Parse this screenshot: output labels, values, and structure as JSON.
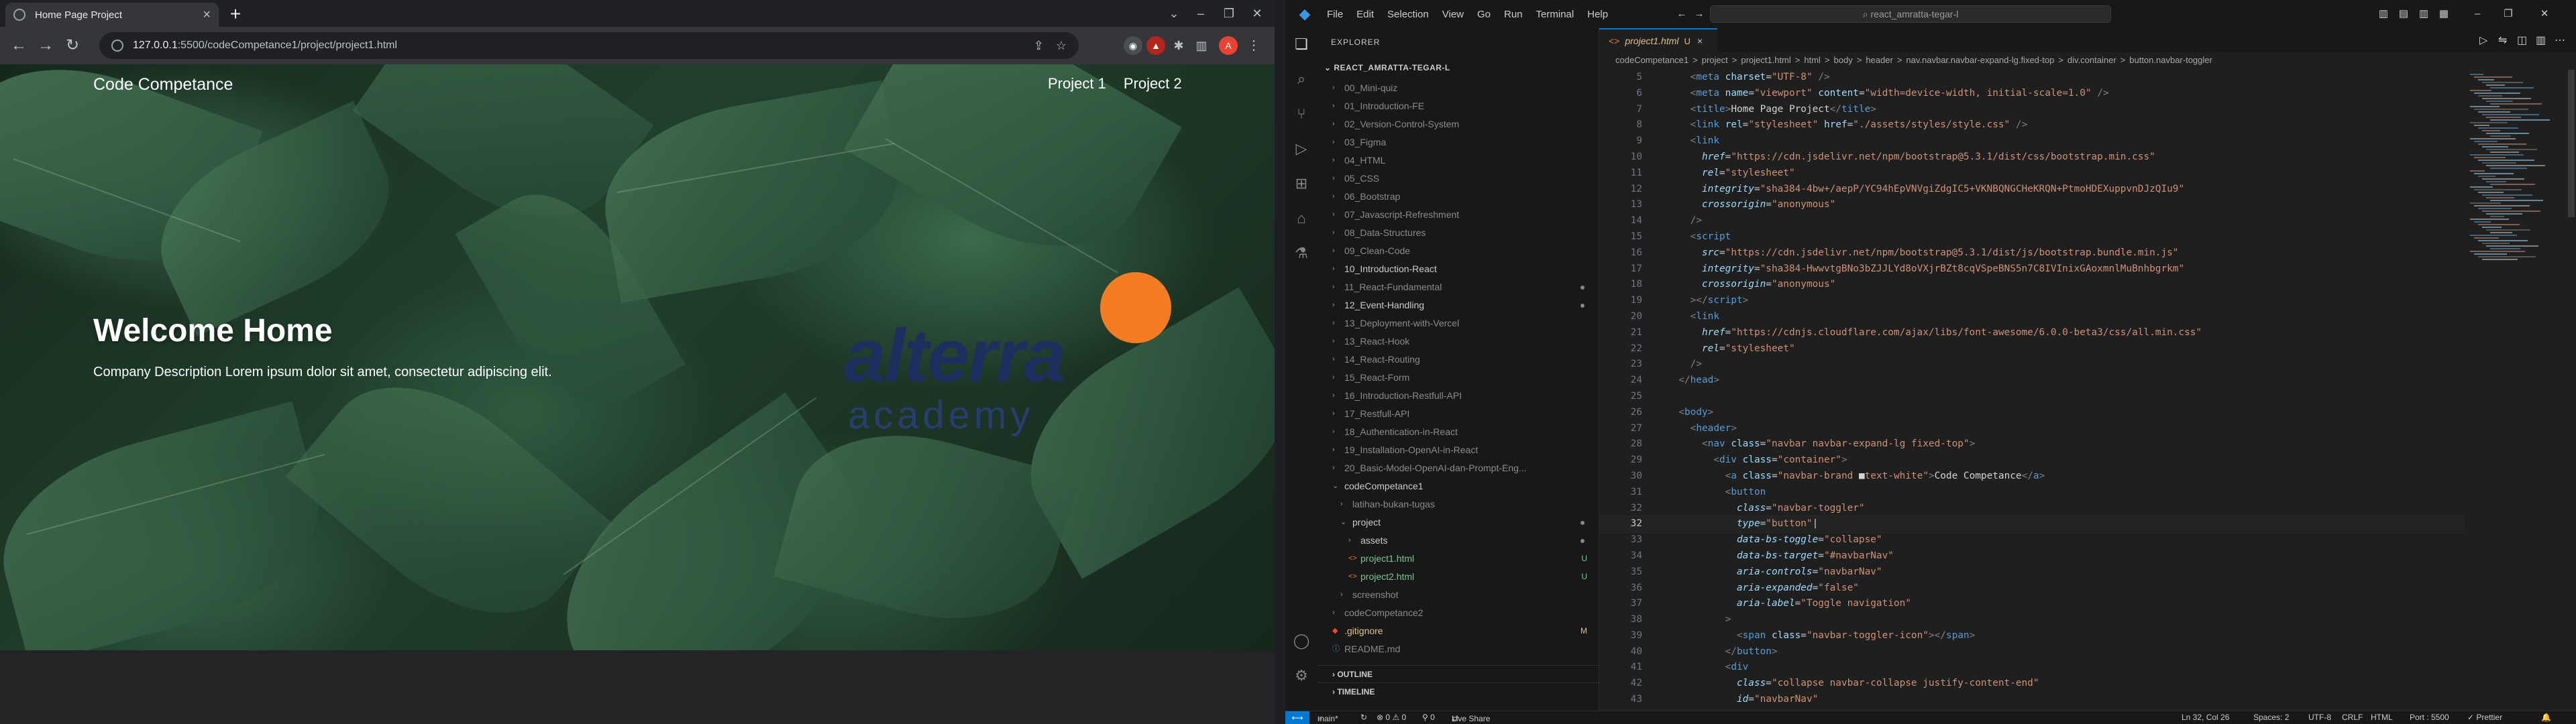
{
  "browser": {
    "tab_title": "Home Page Project",
    "url_host": "127.0.0.1",
    "url_rest": ":5500/codeCompetance1/project/project1.html",
    "profile_initial": "A"
  },
  "webpage": {
    "brand": "Code Competance",
    "nav_links": [
      "Project 1",
      "Project 2"
    ],
    "heading": "Welcome Home",
    "description": "Company Description Lorem ipsum dolor sit amet, consectetur adipiscing elit.",
    "logo_word": "alterra",
    "logo_sub": "academy"
  },
  "vscode": {
    "menu": [
      "File",
      "Edit",
      "Selection",
      "View",
      "Go",
      "Run",
      "Terminal",
      "Help"
    ],
    "command_center": "react_amratta-tegar-l",
    "explorer_title": "EXPLORER",
    "workspace": "REACT_AMRATTA-TEGAR-L",
    "tree": [
      {
        "label": "00_Mini-quiz",
        "indent": 1,
        "kind": "folder",
        "style": "dim"
      },
      {
        "label": "01_Introduction-FE",
        "indent": 1,
        "kind": "folder",
        "style": "dim"
      },
      {
        "label": "02_Version-Control-System",
        "indent": 1,
        "kind": "folder",
        "style": "dim"
      },
      {
        "label": "03_Figma",
        "indent": 1,
        "kind": "folder",
        "style": "dim"
      },
      {
        "label": "04_HTML",
        "indent": 1,
        "kind": "folder",
        "style": "dim"
      },
      {
        "label": "05_CSS",
        "indent": 1,
        "kind": "folder",
        "style": "dim"
      },
      {
        "label": "06_Bootstrap",
        "indent": 1,
        "kind": "folder",
        "style": "dim"
      },
      {
        "label": "07_Javascript-Refreshment",
        "indent": 1,
        "kind": "folder",
        "style": "dim"
      },
      {
        "label": "08_Data-Structures",
        "indent": 1,
        "kind": "folder",
        "style": "dim"
      },
      {
        "label": "09_Clean-Code",
        "indent": 1,
        "kind": "folder",
        "style": "dim"
      },
      {
        "label": "10_Introduction-React",
        "indent": 1,
        "kind": "folder",
        "style": "normal"
      },
      {
        "label": "11_React-Fundamental",
        "indent": 1,
        "kind": "folder",
        "style": "dim",
        "dot": true
      },
      {
        "label": "12_Event-Handling",
        "indent": 1,
        "kind": "folder",
        "style": "normal",
        "dot": true
      },
      {
        "label": "13_Deployment-with-Vercel",
        "indent": 1,
        "kind": "folder",
        "style": "dim"
      },
      {
        "label": "13_React-Hook",
        "indent": 1,
        "kind": "folder",
        "style": "dim"
      },
      {
        "label": "14_React-Routing",
        "indent": 1,
        "kind": "folder",
        "style": "dim"
      },
      {
        "label": "15_React-Form",
        "indent": 1,
        "kind": "folder",
        "style": "dim"
      },
      {
        "label": "16_Introduction-Restfull-API",
        "indent": 1,
        "kind": "folder",
        "style": "dim"
      },
      {
        "label": "17_Restfull-API",
        "indent": 1,
        "kind": "folder",
        "style": "dim"
      },
      {
        "label": "18_Authentication-in-React",
        "indent": 1,
        "kind": "folder",
        "style": "dim"
      },
      {
        "label": "19_Installation-OpenAI-in-React",
        "indent": 1,
        "kind": "folder",
        "style": "dim"
      },
      {
        "label": "20_Basic-Model-OpenAI-dan-Prompt-Eng...",
        "indent": 1,
        "kind": "folder",
        "style": "dim"
      },
      {
        "label": "codeCompetance1",
        "indent": 1,
        "kind": "folder-open",
        "style": "normal"
      },
      {
        "label": "latihan-bukan-tugas",
        "indent": 2,
        "kind": "folder",
        "style": "dim"
      },
      {
        "label": "project",
        "indent": 2,
        "kind": "folder-open",
        "style": "normal",
        "dot": true
      },
      {
        "label": "assets",
        "indent": 3,
        "kind": "folder",
        "style": "normal",
        "dot": true
      },
      {
        "label": "project1.html",
        "indent": 3,
        "kind": "html",
        "style": "green",
        "status": "U"
      },
      {
        "label": "project2.html",
        "indent": 3,
        "kind": "html",
        "style": "green",
        "status": "U"
      },
      {
        "label": "screenshot",
        "indent": 2,
        "kind": "folder",
        "style": "dim"
      },
      {
        "label": "codeCompetance2",
        "indent": 1,
        "kind": "folder",
        "style": "dim"
      },
      {
        "label": ".gitignore",
        "indent": 1,
        "kind": "git",
        "style": "orange",
        "status": "M"
      },
      {
        "label": "README.md",
        "indent": 1,
        "kind": "md",
        "style": "dim"
      }
    ],
    "outline": "OUTLINE",
    "timeline": "TIMELINE",
    "editor_tab": "project1.html",
    "editor_tab_status": "U",
    "breadcrumbs": [
      "codeCompetance1",
      ">",
      "project",
      ">",
      "project1.html",
      ">",
      "html",
      ">",
      "body",
      ">",
      "header",
      ">",
      "nav.navbar.navbar-expand-lg.fixed-top",
      ">",
      "div.container",
      ">",
      "button.navbar-toggler"
    ],
    "code_lines": [
      {
        "n": "5",
        "html": "    <span class='p'>&lt;</span><span class='t'>meta</span> <span class='a'>charset</span>=<span class='s'>\"UTF-8\"</span> <span class='p'>/&gt;</span>"
      },
      {
        "n": "6",
        "html": "    <span class='p'>&lt;</span><span class='t'>meta</span> <span class='a'>name</span>=<span class='s'>\"viewport\"</span> <span class='a'>content</span>=<span class='s'>\"width=device-width, initial-scale=1.0\"</span> <span class='p'>/&gt;</span>"
      },
      {
        "n": "7",
        "html": "    <span class='p'>&lt;</span><span class='t'>title</span><span class='p'>&gt;</span><span class='c'>Home Page Project</span><span class='p'>&lt;/</span><span class='t'>title</span><span class='p'>&gt;</span>"
      },
      {
        "n": "8",
        "html": "    <span class='p'>&lt;</span><span class='t'>link</span> <span class='a'>rel</span>=<span class='s'>\"stylesheet\"</span> <span class='a'>href</span>=<span class='s'>\"./assets/styles/style.css\"</span> <span class='p'>/&gt;</span>"
      },
      {
        "n": "9",
        "html": "    <span class='p'>&lt;</span><span class='t'>link</span>"
      },
      {
        "n": "10",
        "html": "      <span class='a i'>href</span>=<span class='s'>\"https://cdn.jsdelivr.net/npm/bootstrap@5.3.1/dist/css/bootstrap.min.css\"</span>"
      },
      {
        "n": "11",
        "html": "      <span class='a i'>rel</span>=<span class='s'>\"stylesheet\"</span>"
      },
      {
        "n": "12",
        "html": "      <span class='a i'>integrity</span>=<span class='s'>\"sha384-4bw+/aepP/YC94hEpVNVgiZdgIC5+VKNBQNGCHeKRQN+PtmoHDEXuppvnDJzQIu9\"</span>"
      },
      {
        "n": "13",
        "html": "      <span class='a i'>crossorigin</span>=<span class='s'>\"anonymous\"</span>"
      },
      {
        "n": "14",
        "html": "    <span class='p'>/&gt;</span>"
      },
      {
        "n": "15",
        "html": "    <span class='p'>&lt;</span><span class='t'>script</span>"
      },
      {
        "n": "16",
        "html": "      <span class='a i'>src</span>=<span class='s'>\"https://cdn.jsdelivr.net/npm/bootstrap@5.3.1/dist/js/bootstrap.bundle.min.js\"</span>"
      },
      {
        "n": "17",
        "html": "      <span class='a i'>integrity</span>=<span class='s'>\"sha384-HwwvtgBNo3bZJJLYd8oVXjrBZt8cqVSpeBNS5n7C8IVInixGAoxmnlMuBnhbgrkm\"</span>"
      },
      {
        "n": "18",
        "html": "      <span class='a i'>crossorigin</span>=<span class='s'>\"anonymous\"</span>"
      },
      {
        "n": "19",
        "html": "    <span class='p'>&gt;&lt;/</span><span class='t'>script</span><span class='p'>&gt;</span>"
      },
      {
        "n": "20",
        "html": "    <span class='p'>&lt;</span><span class='t'>link</span>"
      },
      {
        "n": "21",
        "html": "      <span class='a i'>href</span>=<span class='s'>\"https://cdnjs.cloudflare.com/ajax/libs/font-awesome/6.0.0-beta3/css/all.min.css\"</span>"
      },
      {
        "n": "22",
        "html": "      <span class='a i'>rel</span>=<span class='s'>\"stylesheet\"</span>"
      },
      {
        "n": "23",
        "html": "    <span class='p'>/&gt;</span>"
      },
      {
        "n": "24",
        "html": "  <span class='p'>&lt;/</span><span class='t'>head</span><span class='p'>&gt;</span>"
      },
      {
        "n": "25",
        "html": ""
      },
      {
        "n": "26",
        "html": "  <span class='p'>&lt;</span><span class='t'>body</span><span class='p'>&gt;</span>"
      },
      {
        "n": "27",
        "html": "    <span class='p'>&lt;</span><span class='t'>header</span><span class='p'>&gt;</span>"
      },
      {
        "n": "28",
        "html": "      <span class='p'>&lt;</span><span class='t'>nav</span> <span class='a'>class</span>=<span class='s'>\"navbar navbar-expand-lg fixed-top\"</span><span class='p'>&gt;</span>"
      },
      {
        "n": "29",
        "html": "        <span class='p'>&lt;</span><span class='t'>div</span> <span class='a'>class</span>=<span class='s'>\"container\"</span><span class='p'>&gt;</span>"
      },
      {
        "n": "30",
        "html": "          <span class='p'>&lt;</span><span class='t'>a</span> <span class='a'>class</span>=<span class='s'>\"navbar-brand </span><span class='c'>&#9632;</span><span class='s'>text-white\"</span><span class='p'>&gt;</span><span class='c'>Code Competance</span><span class='p'>&lt;/</span><span class='t'>a</span><span class='p'>&gt;</span>"
      },
      {
        "n": "31",
        "html": "          <span class='p'>&lt;</span><span class='t'>button</span>"
      },
      {
        "n": "32",
        "html": "            <span class='a i'>class</span>=<span class='s'>\"navbar-toggler\"</span>"
      },
      {
        "n": "32",
        "html": "            <span class='a i'>type</span>=<span class='s'>\"button\"</span><span class='c'>|</span>",
        "cur": true
      },
      {
        "n": "33",
        "html": "            <span class='a i'>data-bs-toggle</span>=<span class='s'>\"collapse\"</span>"
      },
      {
        "n": "34",
        "html": "            <span class='a i'>data-bs-target</span>=<span class='s'>\"#navbarNav\"</span>"
      },
      {
        "n": "35",
        "html": "            <span class='a i'>aria-controls</span>=<span class='s'>\"navbarNav\"</span>"
      },
      {
        "n": "36",
        "html": "            <span class='a i'>aria-expanded</span>=<span class='s'>\"false\"</span>"
      },
      {
        "n": "37",
        "html": "            <span class='a i'>aria-label</span>=<span class='s'>\"Toggle navigation\"</span>"
      },
      {
        "n": "38",
        "html": "          <span class='p'>&gt;</span>"
      },
      {
        "n": "39",
        "html": "            <span class='p'>&lt;</span><span class='t'>span</span> <span class='a'>class</span>=<span class='s'>\"navbar-toggler-icon\"</span><span class='p'>&gt;&lt;/</span><span class='t'>span</span><span class='p'>&gt;</span>"
      },
      {
        "n": "40",
        "html": "          <span class='p'>&lt;/</span><span class='t'>button</span><span class='p'>&gt;</span>"
      },
      {
        "n": "41",
        "html": "          <span class='p'>&lt;</span><span class='t'>div</span>"
      },
      {
        "n": "42",
        "html": "            <span class='a i'>class</span>=<span class='s'>\"collapse navbar-collapse justify-content-end\"</span>"
      },
      {
        "n": "43",
        "html": "            <span class='a i'>id</span>=<span class='s'>\"navbarNav\"</span>"
      }
    ],
    "status": {
      "branch": "main*",
      "sync": "↻",
      "problems": "⊗ 0 ⚠ 0",
      "ports": "⚲ 0",
      "live_share": "Live Share",
      "position": "Ln 32, Col 26",
      "spaces": "Spaces: 2",
      "encoding": "UTF-8",
      "eol": "CRLF",
      "language": "HTML",
      "port": "Port : 5500",
      "prettier": "✓ Prettier"
    }
  }
}
